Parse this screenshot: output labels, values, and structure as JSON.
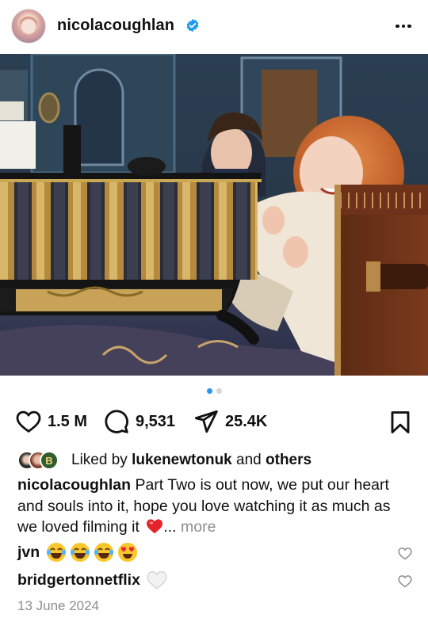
{
  "post": {
    "username": "nicolacoughlan",
    "verified": true,
    "menu_icon": "more-horizontal-icon"
  },
  "photo": {
    "alt_label": "post-photo"
  },
  "carousel": {
    "total": 2,
    "active": 1
  },
  "actions": {
    "likes": "1.5 M",
    "comments": "9,531",
    "shares": "25.4K"
  },
  "liked_by": {
    "prefix": "Liked by",
    "user": "lukenewtonuk",
    "joiner": "and",
    "others": "others",
    "badge_letter": "B"
  },
  "caption": {
    "user": "nicolacoughlan",
    "text": "Part Two is out now, we put our heart and souls into it, hope you love watching it as much as we loved filming it",
    "ellipsis": "...",
    "more": "more"
  },
  "comments": [
    {
      "user": "jvn",
      "emojis": [
        "tears-of-joy",
        "tears-of-joy",
        "tears-of-joy",
        "heart-eyes"
      ]
    },
    {
      "user": "bridgertonnetflix",
      "emojis": [
        "white-heart"
      ]
    }
  ],
  "date": "13 June 2024",
  "colors": {
    "accent": "#2b93f0",
    "verified": "#1d9bf0",
    "muted": "#8e8e8e",
    "heart_red": "#e0245e"
  }
}
